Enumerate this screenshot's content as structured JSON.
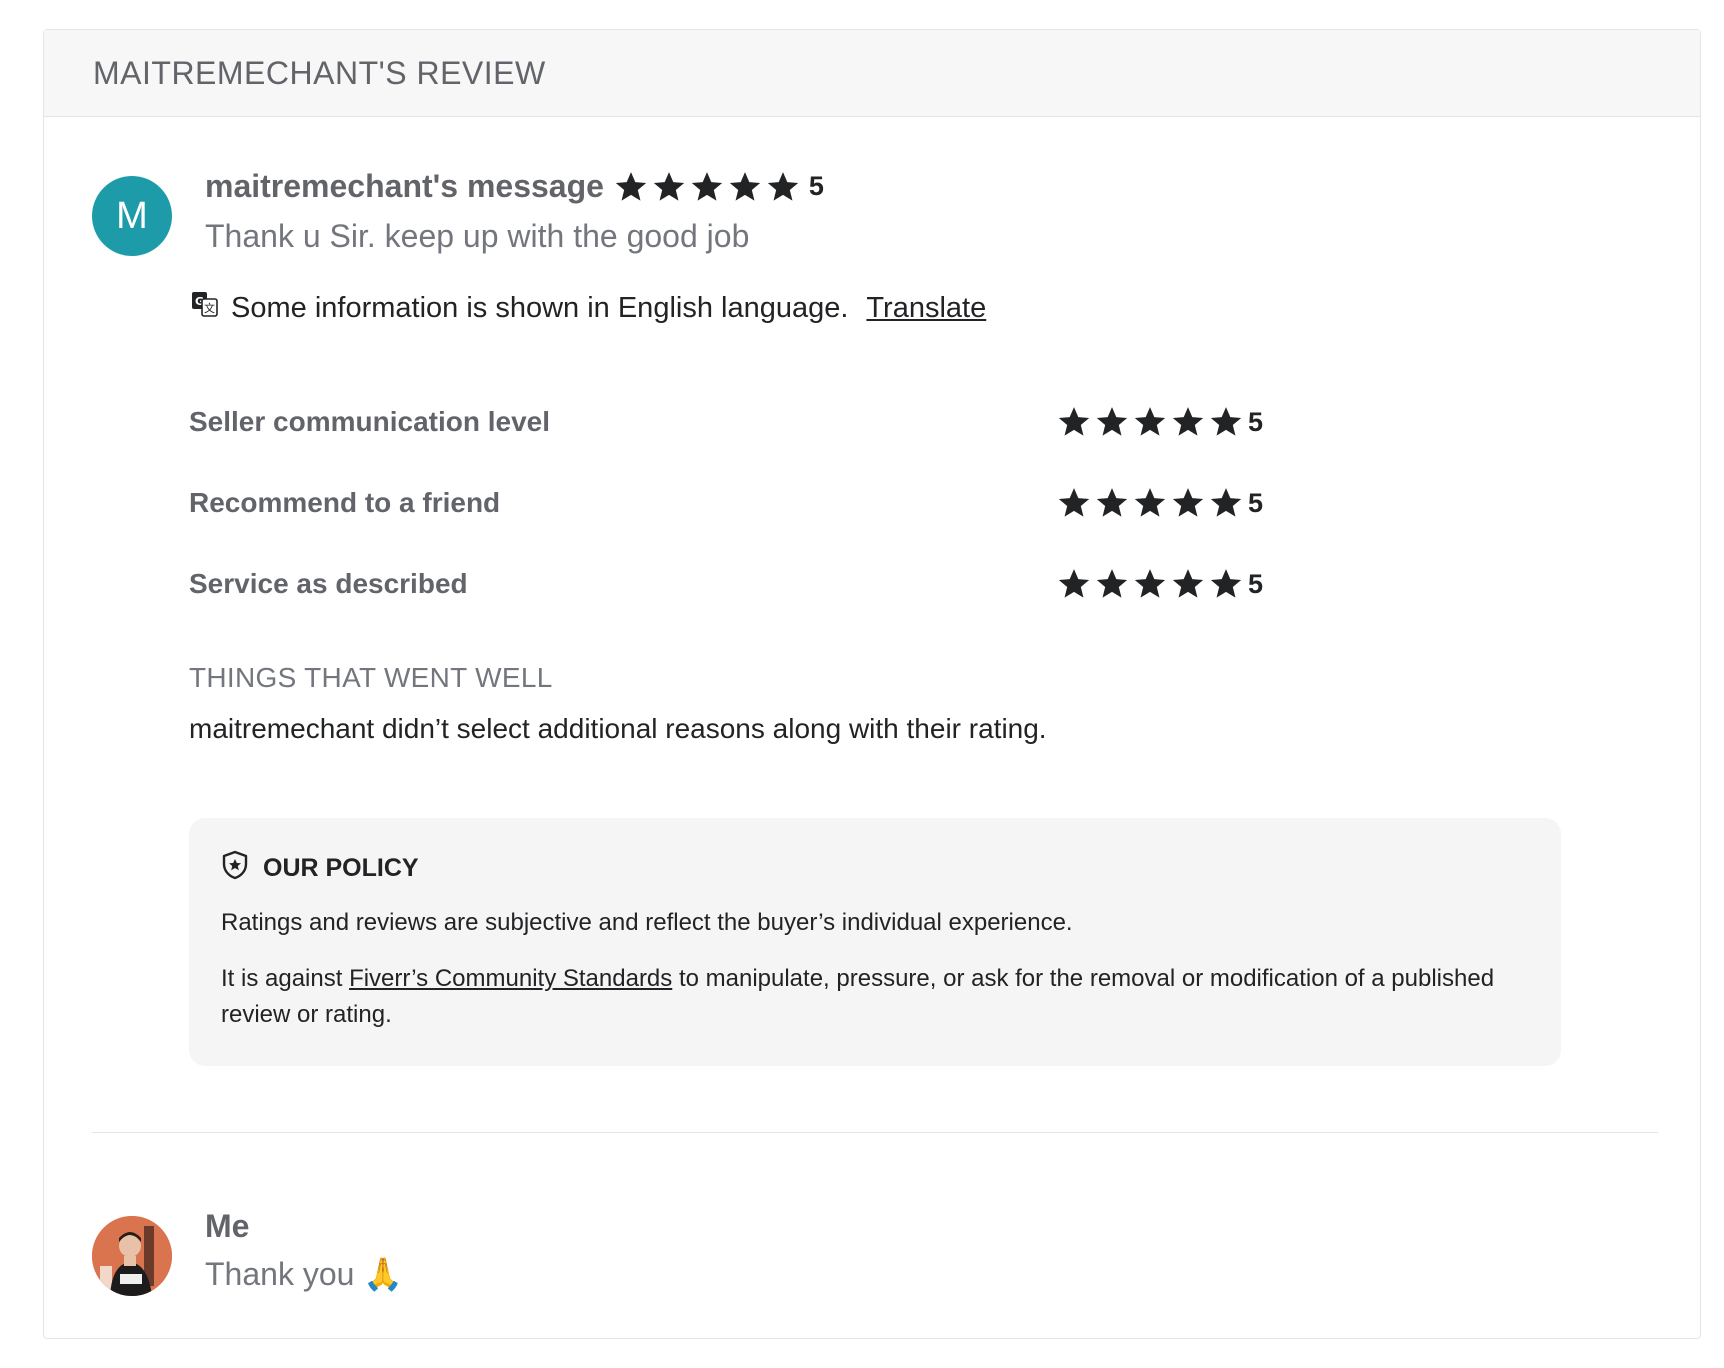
{
  "header": {
    "title": "MAITREMECHANT'S REVIEW"
  },
  "review": {
    "avatar_letter": "M",
    "author_label": "maitremechant's message",
    "rating": 5,
    "rating_text": "5",
    "message": "Thank u Sir. keep up with the good job",
    "translate_notice": "Some information is shown in English language.",
    "translate_link": "Translate"
  },
  "ratings": [
    {
      "label": "Seller communication level",
      "value": 5,
      "value_text": "5"
    },
    {
      "label": "Recommend to a friend",
      "value": 5,
      "value_text": "5"
    },
    {
      "label": "Service as described",
      "value": 5,
      "value_text": "5"
    }
  ],
  "went_well": {
    "title": "THINGS THAT WENT WELL",
    "text": "maitremechant didn’t select additional reasons along with their rating."
  },
  "policy": {
    "title": "OUR POLICY",
    "p1": "Ratings and reviews are subjective and reflect the buyer’s individual experience.",
    "p2_before": "It is against ",
    "p2_link": "Fiverr’s Community Standards",
    "p2_after": " to manipulate, pressure, or ask for the removal or modification of a published review or rating."
  },
  "reply": {
    "author": "Me",
    "message": "Thank you 🙏"
  },
  "colors": {
    "avatar_teal": "#1e9ba8",
    "star": "#222325",
    "header_bg": "#f7f7f7",
    "policy_bg": "#f5f5f5"
  },
  "icons": {
    "star": "star-icon",
    "translate": "translate-icon",
    "policy": "shield-star-icon"
  }
}
